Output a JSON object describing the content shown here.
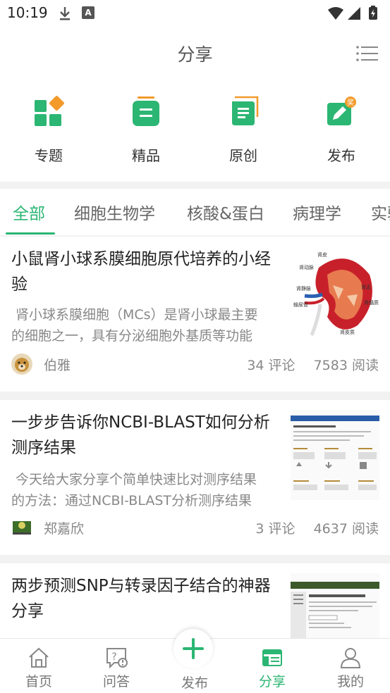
{
  "status_bar": {
    "time": "10:19"
  },
  "header": {
    "title": "分享"
  },
  "quick_nav": [
    {
      "label": "专题",
      "icon": "topics-icon"
    },
    {
      "label": "精品",
      "icon": "premium-icon"
    },
    {
      "label": "原创",
      "icon": "original-icon"
    },
    {
      "label": "发布",
      "icon": "publish-award-icon"
    }
  ],
  "tabs": [
    {
      "label": "全部",
      "active": true
    },
    {
      "label": "细胞生物学",
      "active": false
    },
    {
      "label": "核酸&蛋白",
      "active": false
    },
    {
      "label": "病理学",
      "active": false
    },
    {
      "label": "实验",
      "active": false
    }
  ],
  "articles": [
    {
      "title": "小鼠肾小球系膜细胞原代培养的小经验",
      "summary": "肾小球系膜细胞（MCs）是肾小球最主要的细胞之一，具有分泌细胞外基质等功能",
      "author": "伯雅",
      "comments": "34 评论",
      "reads": "7583 阅读",
      "thumb_labels": [
        "肾皮",
        "肾动脉",
        "肾静脉",
        "输尿管",
        "肾髓质",
        "肾盂",
        "肾皮质"
      ]
    },
    {
      "title": "一步步告诉你NCBI-BLAST如何分析测序结果",
      "summary": "今天给大家分享个简单快速比对测序结果的方法：通过NCBI-BLAST分析测序结果",
      "author": "郑嘉欣",
      "comments": "3 评论",
      "reads": "4637 阅读"
    },
    {
      "title": "两步预测SNP与转录因子结合的神器分享",
      "summary": "",
      "author": "",
      "comments": "",
      "reads": ""
    }
  ],
  "bottom_nav": [
    {
      "label": "首页",
      "icon": "home-icon",
      "active": false
    },
    {
      "label": "问答",
      "icon": "qa-icon",
      "active": false
    },
    {
      "label": "发布",
      "icon": "plus-icon",
      "active": false
    },
    {
      "label": "分享",
      "icon": "share-icon",
      "active": true
    },
    {
      "label": "我的",
      "icon": "profile-icon",
      "active": false
    }
  ],
  "colors": {
    "accent": "#2bb673",
    "accent_orange": "#f39a2b"
  }
}
